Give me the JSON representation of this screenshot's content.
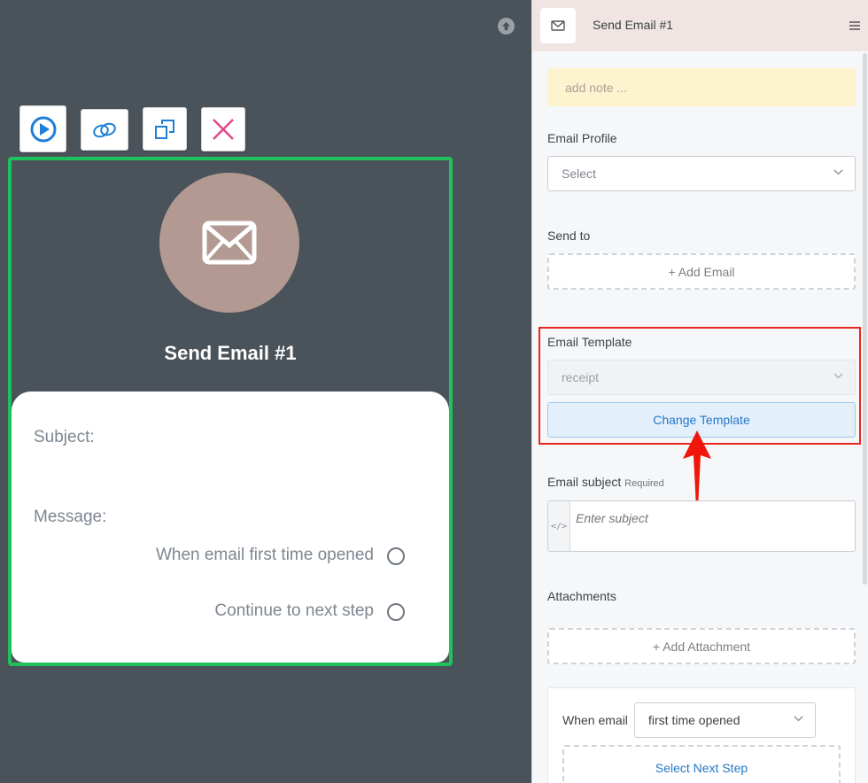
{
  "canvas": {
    "node": {
      "title": "Send Email #1",
      "subject_label": "Subject:",
      "message_label": "Message:",
      "options": [
        "When email first time opened",
        "Continue to next step"
      ]
    }
  },
  "panel": {
    "header_title": "Send Email #1",
    "note_placeholder": "add note ...",
    "email_profile": {
      "label": "Email Profile",
      "value": "Select"
    },
    "send_to": {
      "label": "Send to",
      "add_label": "+ Add Email"
    },
    "email_template": {
      "label": "Email Template",
      "value": "receipt",
      "change_label": "Change Template"
    },
    "email_subject": {
      "label": "Email subject",
      "required": "Required",
      "placeholder": "Enter subject",
      "code_glyph": "</>"
    },
    "attachments": {
      "label": "Attachments",
      "add_label": "+ Add Attachment"
    },
    "when": {
      "label": "When email",
      "value": "first time opened",
      "next_step": "Select Next Step"
    }
  },
  "colors": {
    "node_border": "#1fc15c",
    "highlight": "#e8261d",
    "accent": "#2478c7",
    "avatar": "#b29a93"
  }
}
